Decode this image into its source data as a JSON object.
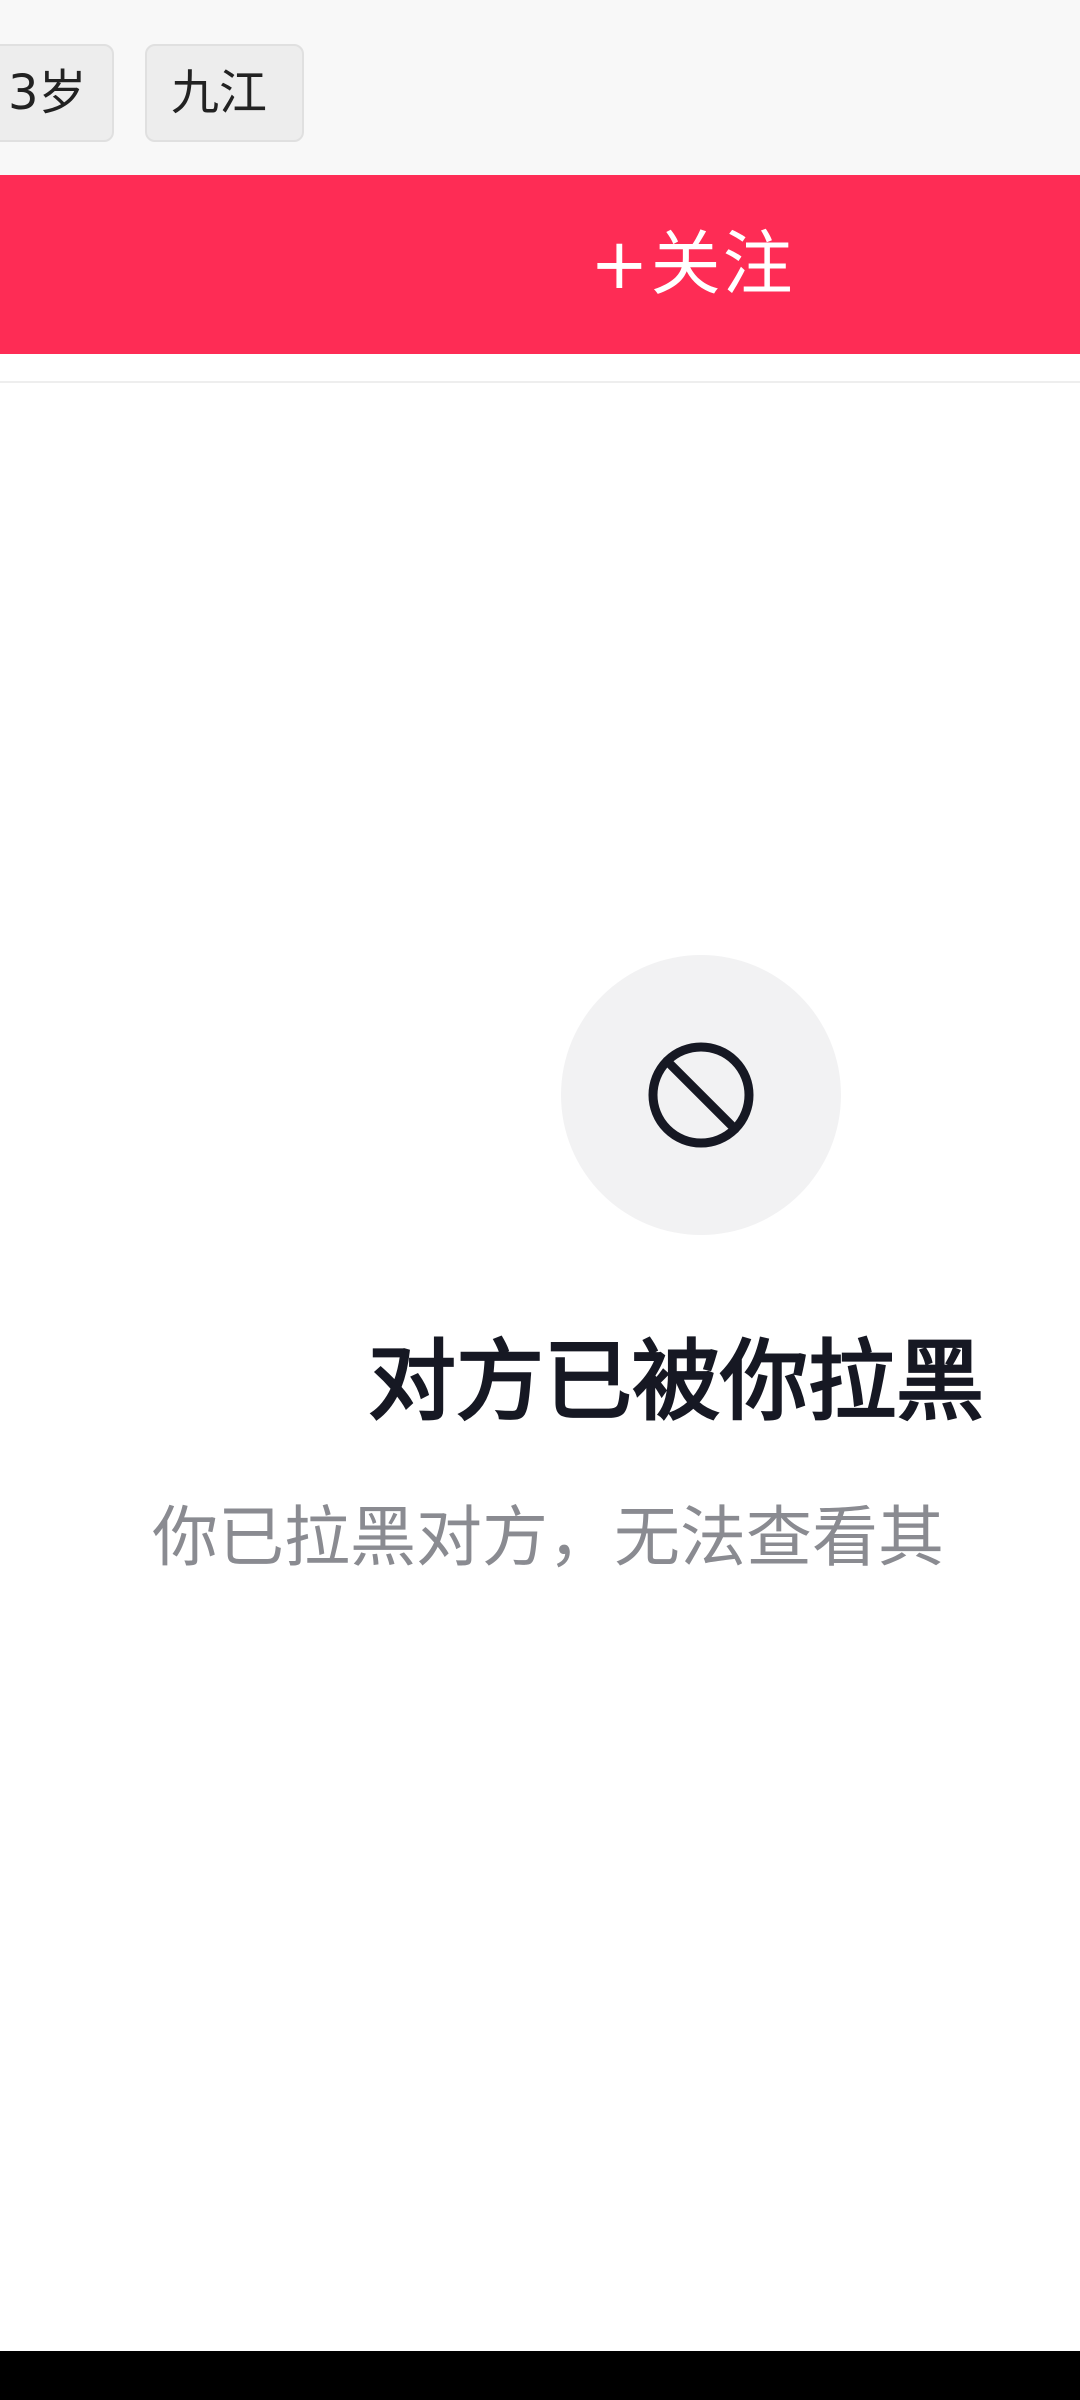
{
  "profile": {
    "tags": {
      "age": "3岁",
      "city": "九江"
    },
    "follow_label": "+关注"
  },
  "blocked": {
    "icon": "block-icon",
    "title": "对方已被你拉黑",
    "description": "你已拉黑对方，无法查看其"
  },
  "colors": {
    "accent": "#fe2c55",
    "title": "#161823",
    "subtitle": "#8a8b91"
  }
}
